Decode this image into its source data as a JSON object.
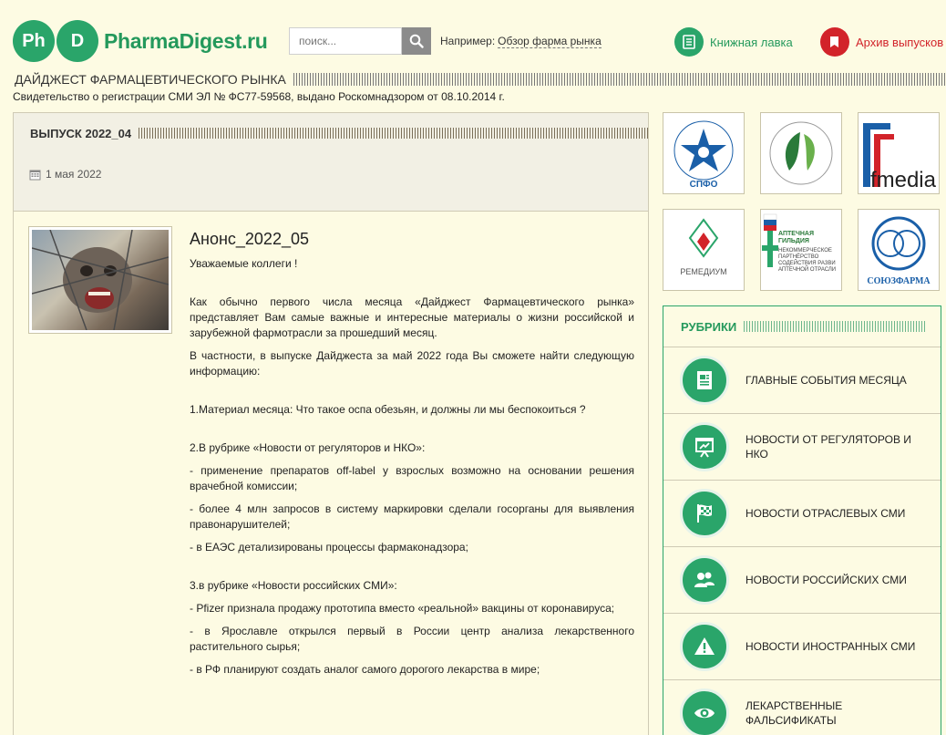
{
  "header": {
    "logo_left": "Ph",
    "logo_right": "D",
    "logo_text": "PharmaDigest.ru",
    "search_placeholder": "поиск...",
    "example_label": "Например:",
    "example_link": "Обзор фарма рынка",
    "books_link": "Книжная лавка",
    "archive_link": "Архив выпусков",
    "site_title": "ДАЙДЖЕСТ ФАРМАЦЕВТИЧЕСКОГО РЫНКА",
    "license": "Свидетельство о регистрации СМИ ЭЛ № ФС77-59568, выдано Роскомнадзором от 08.10.2014 г."
  },
  "issue": {
    "title": "ВЫПУСК 2022_04",
    "date": "1 мая 2022"
  },
  "article": {
    "title": "Анонс_2022_05",
    "greeting": "Уважаемые коллеги !",
    "p1": "Как обычно первого числа месяца «Дайджест Фармацевтического рынка» представляет Вам самые важные и интересные материалы о жизни российской и зарубежной фармотрасли за прошедший месяц.",
    "p2": "В частности, в выпуске Дайджеста за май 2022 года Вы сможете найти следующую информацию:",
    "item1": "1.Материал месяца: Что такое оспа обезьян, и должны ли мы беспокоиться ?",
    "item2": "2.В рубрике «Новости от регуляторов и НКО»:",
    "item2_a": "- применение препаратов off-label у взрослых возможно на основании решения врачебной комиссии;",
    "item2_b": "- более 4 млн запросов в систему маркировки сделали госорганы для выявления правонарушителей;",
    "item2_c": "- в ЕАЭС детализированы процессы фармаконадзора;",
    "item3": "3.в рубрике «Новости российских СМИ»:",
    "item3_a": "- Pfizer признала продажу прототипа вместо «реальной» вакцины от коронавируса;",
    "item3_b": "- в Ярославле открылся первый в России центр анализа лекарственного растительного сырья;",
    "item3_c": "- в РФ планируют создать аналог самого дорогого лекарства в мире;"
  },
  "partners": {
    "spfo": "СПФО",
    "ffmedia": "fmedia",
    "remedium": "РЕМЕДИУМ",
    "guild_title": "АПТЕЧНАЯ ГИЛЬДИЯ",
    "guild_sub": "НЕКОММЕРЧЕСКОЕ ПАРТНЁРСТВО СОДЕЙСТВИЯ РАЗВИ АПТЕЧНОЙ ОТРАСЛИ",
    "soyuzfarma": "СОЮЗФАРМА"
  },
  "rubrics": {
    "title": "РУБРИКИ",
    "items": [
      {
        "label": "ГЛАВНЫЕ СОБЫТИЯ МЕСЯЦА",
        "icon": "document-icon"
      },
      {
        "label": "НОВОСТИ ОТ РЕГУЛЯТОРОВ И НКО",
        "icon": "presentation-icon"
      },
      {
        "label": "НОВОСТИ ОТРАСЛЕВЫХ СМИ",
        "icon": "checkered-flag-icon"
      },
      {
        "label": "НОВОСТИ РОССИЙСКИХ СМИ",
        "icon": "users-icon"
      },
      {
        "label": "НОВОСТИ ИНОСТРАННЫХ СМИ",
        "icon": "warning-icon"
      },
      {
        "label": "ЛЕКАРСТВЕННЫЕ ФАЛЬСИФИКАТЫ",
        "icon": "eye-icon"
      }
    ]
  },
  "colors": {
    "brand_green": "#2aa56a",
    "archive_red": "#d2232a",
    "page_bg": "#fdfbe3"
  }
}
